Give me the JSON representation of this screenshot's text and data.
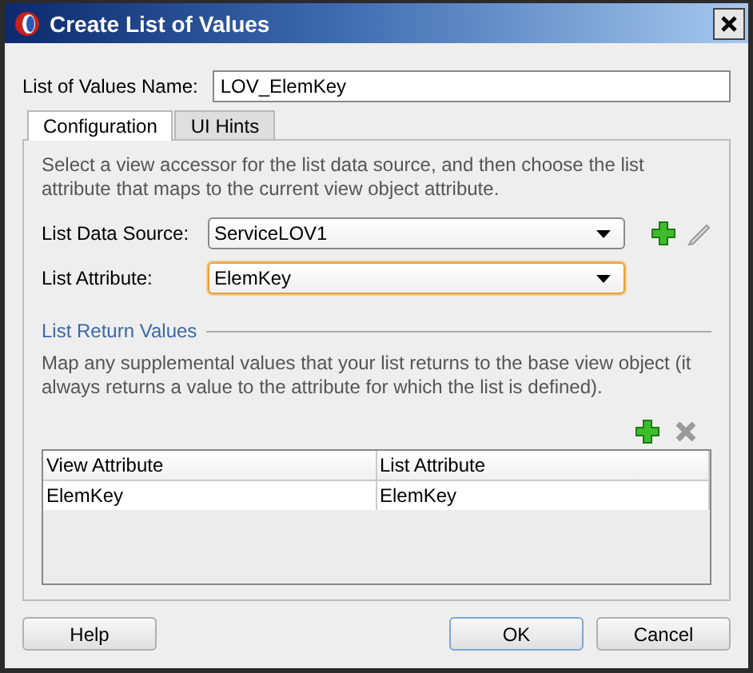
{
  "window": {
    "title": "Create List of Values"
  },
  "name_field": {
    "label": "List of Values Name:",
    "value": "LOV_ElemKey"
  },
  "tabs": [
    {
      "label": "Configuration",
      "selected": true
    },
    {
      "label": "UI Hints",
      "selected": false
    }
  ],
  "intro": "Select a view accessor for the list data source, and then choose the list attribute that maps to the current view object attribute.",
  "data_source": {
    "label": "List Data Source:",
    "value": "ServiceLOV1"
  },
  "list_attribute": {
    "label": "List Attribute:",
    "value": "ElemKey",
    "focused": true
  },
  "return_values": {
    "heading": "List Return Values",
    "description": "Map any supplemental values that your list returns to the base view object (it always returns a value to the attribute for which the list is defined).",
    "table": {
      "columns": [
        "View Attribute",
        "List Attribute"
      ],
      "rows": [
        {
          "cells": [
            "ElemKey",
            "ElemKey"
          ],
          "selected": false
        }
      ]
    }
  },
  "buttons": [
    {
      "label": "Help",
      "kind": "help"
    },
    {
      "label": "OK",
      "kind": "default"
    },
    {
      "label": "Cancel",
      "kind": "normal"
    }
  ]
}
